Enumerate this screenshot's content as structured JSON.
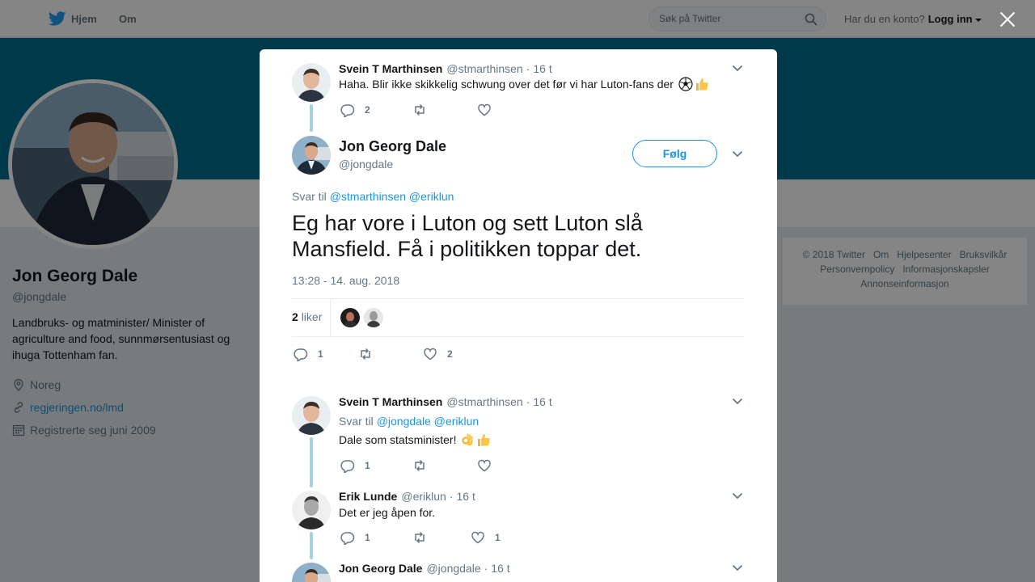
{
  "topbar": {
    "home_label": "Hjem",
    "about_label": "Om",
    "search_placeholder": "Søk på Twitter",
    "account_prompt": "Har du en konto?",
    "login_label": "Logg inn"
  },
  "profile": {
    "name": "Jon Georg Dale",
    "handle": "@jongdale",
    "bio": "Landbruks- og matminister/ Minister of agriculture and food, sunnmørsentusiast og ihuga Tottenham fan.",
    "location": "Noreg",
    "website": "regjeringen.no/lmd",
    "joined": "Registrerte seg juni 2009"
  },
  "footer": {
    "links": [
      "© 2018 Twitter",
      "Om",
      "Hjelpesenter",
      "Bruksvilkår",
      "Personvernpolicy",
      "Informasjonskapsler",
      "Annonseinformasjon"
    ]
  },
  "modal": {
    "parent_tweet": {
      "name": "Svein T Marthinsen",
      "handle": "@stmarthinsen",
      "time": "16 t",
      "text": "Haha. Blir ikke skikkelig schwung over det før vi har Luton-fans der",
      "replies": "2",
      "retweets": "",
      "likes": ""
    },
    "main_tweet": {
      "name": "Jon Georg Dale",
      "handle": "@jongdale",
      "follow_label": "Følg",
      "reply_prefix": "Svar til",
      "reply_mentions": "@stmarthinsen @eriklun",
      "text": "Eg har vore i Luton og sett Luton slå Mansfield. Få i politikken toppar det.",
      "datetime": "13:28 - 14. aug. 2018",
      "likes_count": "2",
      "likes_label": "liker",
      "replies": "1",
      "retweets": "",
      "like_count": "2"
    },
    "replies": [
      {
        "name": "Svein T Marthinsen",
        "handle": "@stmarthinsen",
        "time": "16 t",
        "reply_prefix": "Svar til",
        "reply_mentions": "@jongdale @eriklun",
        "text": "Dale som statsminister!",
        "replies": "1",
        "retweets": "",
        "likes": ""
      },
      {
        "name": "Erik Lunde",
        "handle": "@eriklun",
        "time": "16 t",
        "text": "Det er jeg åpen for.",
        "replies": "1",
        "retweets": "",
        "likes": "1"
      },
      {
        "name": "Jon Georg Dale",
        "handle": "@jongdale",
        "time": "16 t"
      }
    ]
  },
  "colors": {
    "accent": "#1b95e0",
    "banner": "#006d8f",
    "thread_line": "#a3d1e0"
  }
}
